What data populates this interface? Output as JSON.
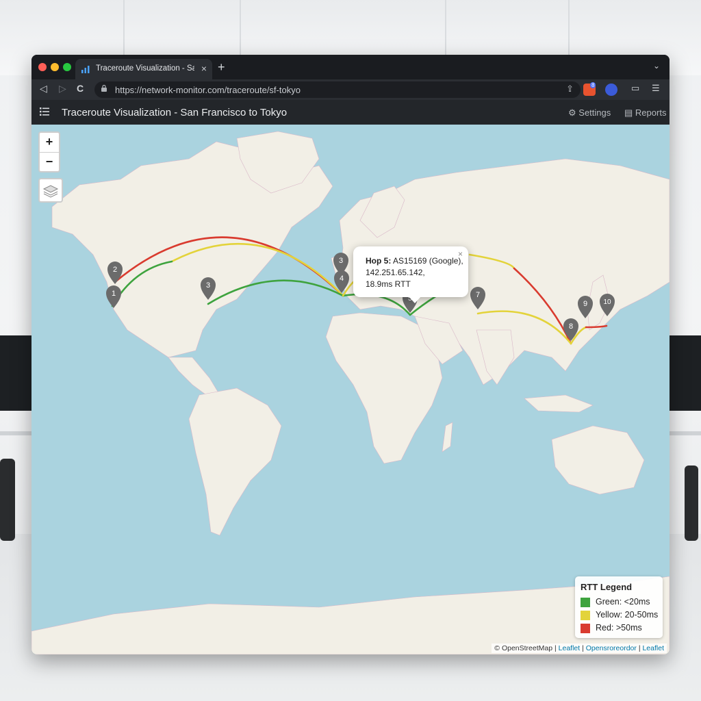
{
  "browser": {
    "tab_title": "Traceroute Visualization - San Francisco to Tokyo",
    "tab_close": "×",
    "new_tab": "+",
    "tab_menu": "⌄",
    "back": "◁",
    "forward": "▷",
    "reload": "C",
    "url": "https://network-monitor.com/traceroute/sf-tokyo",
    "share": "⇪",
    "extension_badge": "8",
    "sidebar_btn": "▭",
    "menu_btn": "☰"
  },
  "app": {
    "title": "Traceroute Visualization - San Francisco to Tokyo",
    "settings_label": "Settings",
    "reports_label": "Reports",
    "settings_icon": "⚙",
    "reports_icon": "▤"
  },
  "map": {
    "zoom_in": "+",
    "zoom_out": "−",
    "hops": [
      "1",
      "2",
      "3",
      "3",
      "4",
      "5",
      "7",
      "8",
      "9",
      "10"
    ],
    "popup": {
      "hop_label": "Hop 5:",
      "asn": "AS15169 (Google),",
      "ip": "142.251.65.142,",
      "rtt": "18.9ms RTT",
      "close": "×"
    },
    "colors": {
      "green": "#3ea33e",
      "yellow": "#e3d33a",
      "red": "#d93b2f",
      "marker": "#6b6b6b",
      "ocean": "#aad3df",
      "land": "#f2efe6"
    }
  },
  "legend": {
    "title": "RTT Legend",
    "items": [
      {
        "label": "Green: <20ms",
        "color": "#3ea33e"
      },
      {
        "label": "Yellow: 20-50ms",
        "color": "#e3d33a"
      },
      {
        "label": "Red: >50ms",
        "color": "#d93b2f"
      }
    ]
  },
  "attribution": {
    "osm": "© OpenStreetMap",
    "sep": "|",
    "leaflet": "Leaflet",
    "other": "Opensroreordor"
  }
}
